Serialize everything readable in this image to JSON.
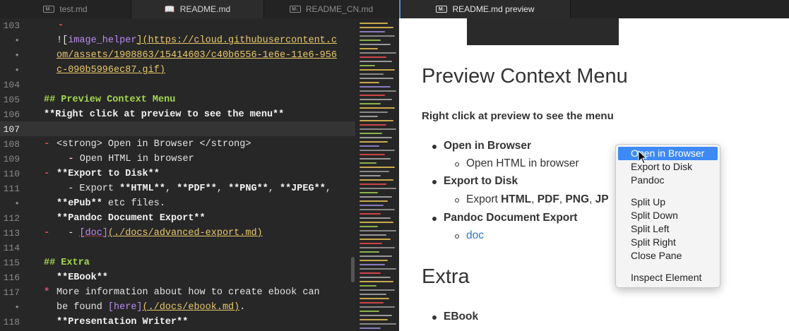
{
  "tabs": [
    {
      "label": "test.md",
      "icon": "markdown-icon"
    },
    {
      "label": "README.md",
      "icon": "book-icon"
    },
    {
      "label": "README_CN.md",
      "icon": "markdown-icon"
    },
    {
      "label": "README.md preview",
      "icon": "markdown-icon"
    }
  ],
  "editor": {
    "line_numbers": [
      "103",
      "•",
      "•",
      "•",
      "104",
      "105",
      "106",
      "107",
      "108",
      "109",
      "110",
      "111",
      "•",
      "112",
      "113",
      "114",
      "115",
      "116",
      "117",
      "•",
      "118"
    ],
    "lines": {
      "l103_dash": "-",
      "l103b_prefix": "![",
      "l103b_alt": "image_helper",
      "l103b_mid": "](",
      "l103b_url": "https://cloud.githubusercontent.c",
      "l103c": "om/assets/1908863/15414603/c40b6556-1e6e-11e6-956",
      "l103d_url": "c-090b5996ec87.gif",
      "l103d_end": ")",
      "l105": "## Preview Context Menu",
      "l106": "**Right click at preview to see the menu**",
      "l108_mark": "-",
      "l108": "<strong> Open in Browser </strong>",
      "l109": "  - Open HTML in browser",
      "l110_mark": "-",
      "l110": "**Export to Disk**",
      "l111_a": "  - Export ",
      "l111_html": "**HTML**",
      "l111_c1": ", ",
      "l111_pdf": "**PDF**",
      "l111_c2": ", ",
      "l111_png": "**PNG**",
      "l111_c3": ", ",
      "l111_jpeg": "**JPEG**",
      "l111_c4": ",",
      "l111b_epub": "**ePub**",
      "l111b_rest": " etc files.",
      "l112_mark": "-",
      "l112": "**Pandoc Document Export**",
      "l113_a": "  - ",
      "l113_alt": "[doc]",
      "l113_url": "(./docs/advanced-export.md)",
      "l115": "## Extra",
      "l116_mark": "*",
      "l116": "**EBook**",
      "l117": "More information about how to create ebook can",
      "l117b_a": "be found ",
      "l117b_alt": "[here]",
      "l117b_url": "(./docs/ebook.md)",
      "l117b_end": ".",
      "l118_mark": "*",
      "l118": "**Presentation Writer**"
    }
  },
  "preview": {
    "heading1": "Preview Context Menu",
    "paragraph": "Right click at preview to see the menu",
    "item1": "Open in Browser",
    "item1_sub": "Open HTML in browser",
    "item2": "Export to Disk",
    "item2_sub_prefix": "Export ",
    "item2_sub_html": "HTML",
    "item2_sub_sep1": ", ",
    "item2_sub_pdf": "PDF",
    "item2_sub_sep2": ", ",
    "item2_sub_png": "PNG",
    "item2_sub_sep3": ", ",
    "item2_sub_jp": "JP",
    "item3": "Pandoc Document Export",
    "item3_sub": "doc",
    "heading2": "Extra",
    "item4": "EBook"
  },
  "context_menu": {
    "items": [
      "Open in Browser",
      "Export to Disk",
      "Pandoc",
      "Split Up",
      "Split Down",
      "Split Left",
      "Split Right",
      "Close Pane",
      "Inspect Element"
    ],
    "highlighted": "Open in Browser",
    "highlight_color": "#3d8af7"
  },
  "colors": {
    "editor_bg": "#272727",
    "heading_green": "#a3d84e",
    "list_marker_red": "#e5484d",
    "link_url_yellow": "#e8c86a",
    "alt_text_purple": "#b98cf0",
    "preview_link_blue": "#2e78c2"
  }
}
